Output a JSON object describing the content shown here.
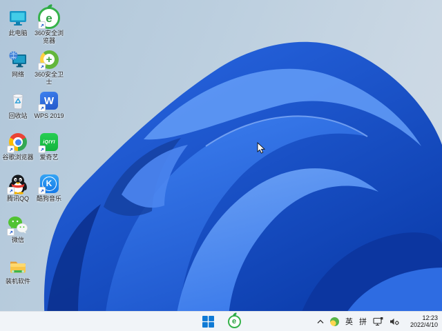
{
  "wallpaper": {
    "name": "windows-11-bloom",
    "bg_top_left": "#b0c6d9",
    "bg_right": "#cfdbe6",
    "bloom_primary": "#2063e6",
    "bloom_dark": "#0a2f8c",
    "bloom_light": "#6aa3f8"
  },
  "desktop": {
    "icons": [
      {
        "id": "this-pc",
        "label": "此电脑",
        "shortcut": false
      },
      {
        "id": "360-browser",
        "label": "360安全浏览器",
        "shortcut": true
      },
      {
        "id": "network",
        "label": "网络",
        "shortcut": false
      },
      {
        "id": "360-guard",
        "label": "360安全卫士",
        "shortcut": true
      },
      {
        "id": "recycle-bin",
        "label": "回收站",
        "shortcut": false
      },
      {
        "id": "wps-2019",
        "label": "WPS 2019",
        "shortcut": true
      },
      {
        "id": "chrome",
        "label": "谷歌浏览器",
        "shortcut": true
      },
      {
        "id": "iqiyi",
        "label": "爱奇艺",
        "shortcut": true
      },
      {
        "id": "tencent-qq",
        "label": "腾讯QQ",
        "shortcut": true
      },
      {
        "id": "kugou-music",
        "label": "酷狗音乐",
        "shortcut": true
      },
      {
        "id": "wechat",
        "label": "微信",
        "shortcut": true
      },
      {
        "id": "software-folder",
        "label": "装机软件",
        "shortcut": false
      }
    ],
    "iqiyi_logo_text": "iQIYI",
    "wps_logo_text": "W",
    "kugou_logo_text": "K",
    "browser_logo_text": "e",
    "guard_plus": "+"
  },
  "taskbar": {
    "center_icons": [
      "start",
      "360-browser"
    ],
    "tray": {
      "chevron": "hidden-icons",
      "ime_english": "英",
      "ime_pinyin": "拼"
    },
    "clock": {
      "time": "12:23",
      "date": "2022/4/10"
    }
  }
}
